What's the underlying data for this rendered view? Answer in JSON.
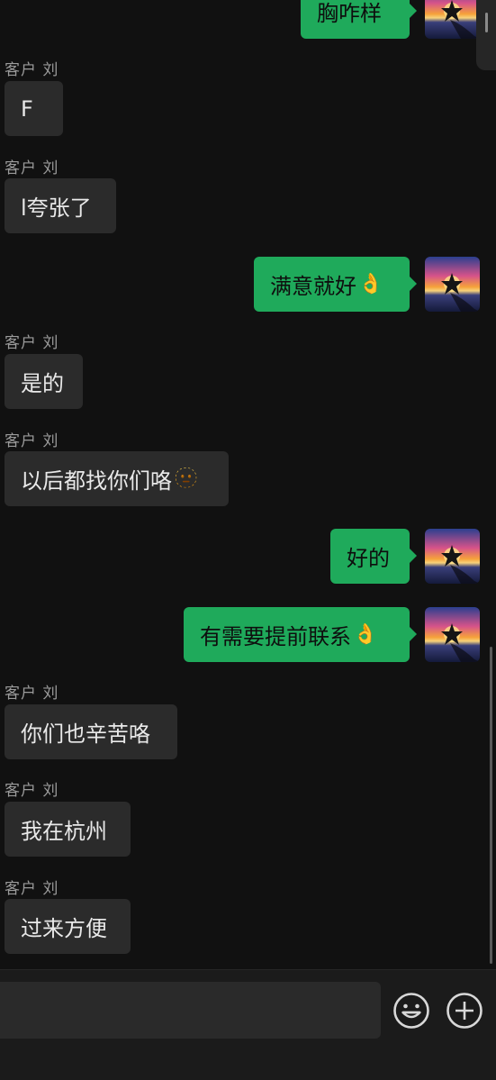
{
  "conversation": {
    "contact_label": "客户 刘",
    "messages": [
      {
        "direction": "out",
        "text": "胸咋样"
      },
      {
        "direction": "in",
        "sender": "客户 刘",
        "text": "F"
      },
      {
        "direction": "in",
        "sender": "客户 刘",
        "text": "l夸张了"
      },
      {
        "direction": "out",
        "text": "满意就好",
        "emoji": "👌"
      },
      {
        "direction": "in",
        "sender": "客户 刘",
        "text": "是的"
      },
      {
        "direction": "in",
        "sender": "客户 刘",
        "text": "以后都找你们咯",
        "emoji": "🫥"
      },
      {
        "direction": "out",
        "text": "好的"
      },
      {
        "direction": "out",
        "text": "有需要提前联系",
        "emoji": "👌"
      },
      {
        "direction": "in",
        "sender": "客户 刘",
        "text": "你们也辛苦咯"
      },
      {
        "direction": "in",
        "sender": "客户 刘",
        "text": "我在杭州"
      },
      {
        "direction": "in",
        "sender": "客户 刘",
        "text": "过来方便"
      }
    ]
  },
  "avatar_icon": "sunset-star-avatar-icon",
  "input_bar": {
    "message_value": "",
    "emoji_icon": "smiley-icon",
    "more_icon": "plus-circle-icon"
  },
  "colors": {
    "background": "#111111",
    "incoming_bubble": "#2b2b2b",
    "outgoing_bubble": "#1faa5b",
    "name_text": "#9b9b9b"
  }
}
